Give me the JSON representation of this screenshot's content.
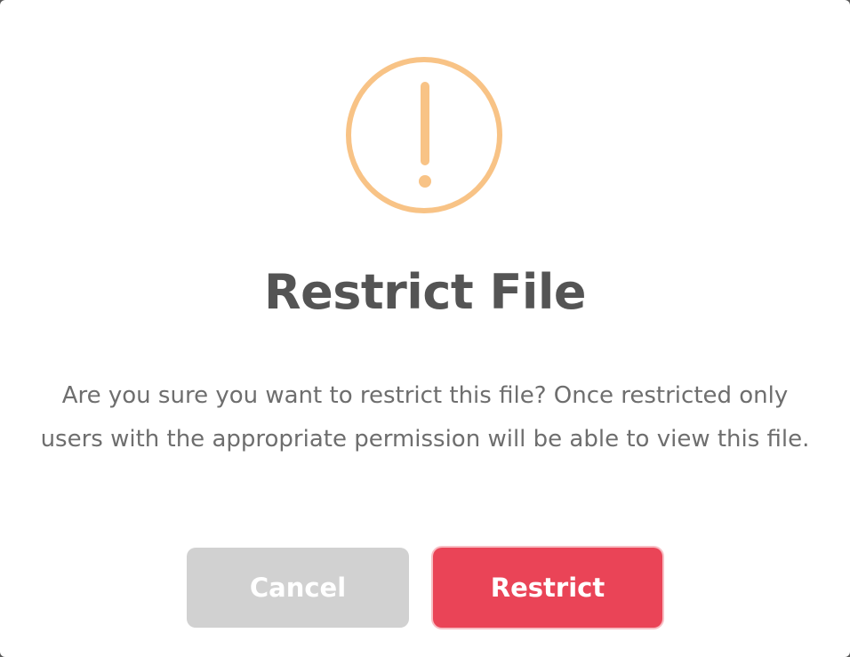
{
  "dialog": {
    "icon": "exclamation-circle-icon",
    "icon_color": "#f8c386",
    "title": "Restrict File",
    "message": "Are you sure you want to restrict this file? Once restricted only users with the appropriate permission will be able to view this file.",
    "cancel_label": "Cancel",
    "confirm_label": "Restrict",
    "confirm_color": "#ea4457",
    "cancel_color": "#d1d1d1"
  }
}
